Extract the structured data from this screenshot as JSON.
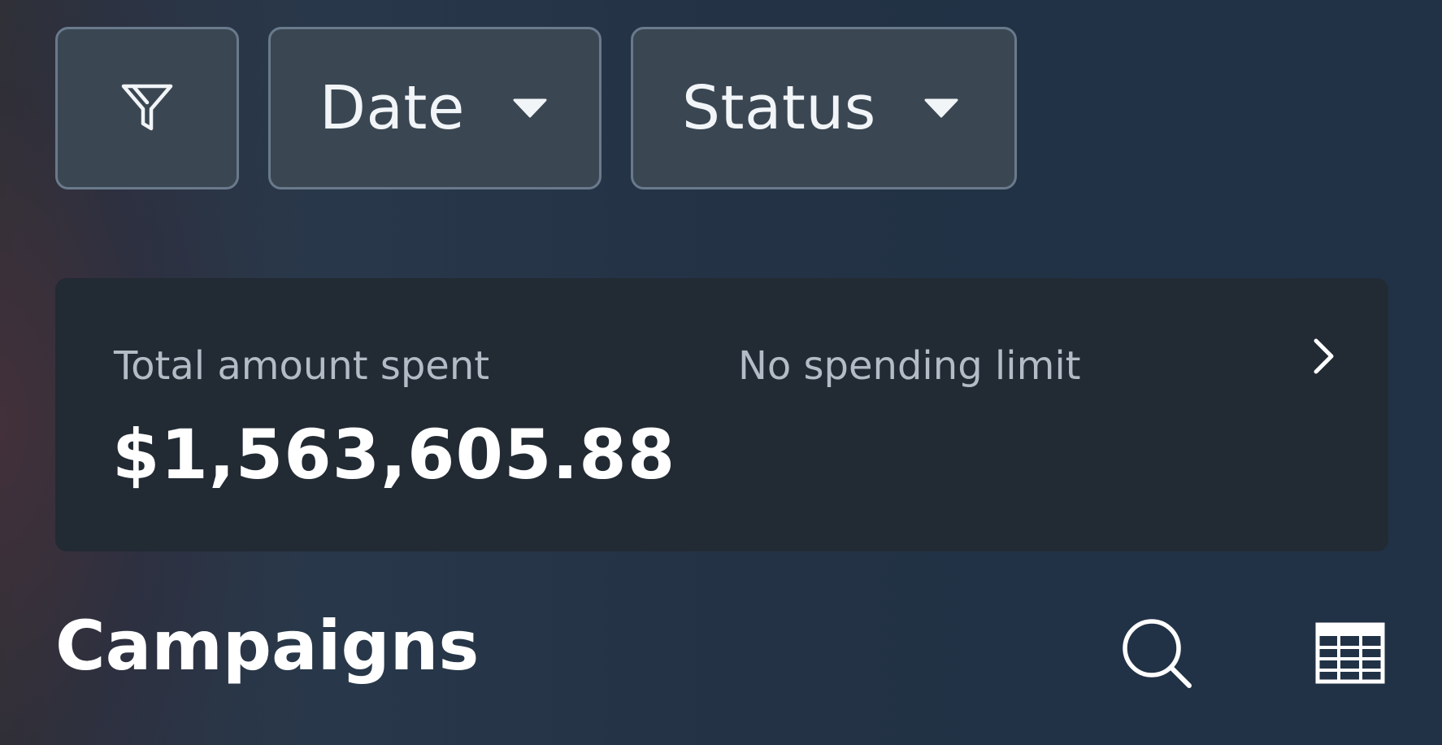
{
  "filters": {
    "filter_icon": "filter-funnel-icon",
    "date_label": "Date",
    "status_label": "Status",
    "caret_icon": "caret-down-icon"
  },
  "summary": {
    "spent_label": "Total amount spent",
    "spent_value": "$1,563,605.88",
    "limit_label": "No spending limit",
    "chevron_icon": "chevron-right-icon"
  },
  "campaigns": {
    "title": "Campaigns",
    "search_icon": "search-icon",
    "table_icon": "table-view-icon"
  },
  "colors": {
    "chip_bg": "#3a4753",
    "chip_border": "#6a7a8c",
    "card_bg": "#222a33",
    "muted_text": "#b3bcc6",
    "text": "#ffffff"
  }
}
